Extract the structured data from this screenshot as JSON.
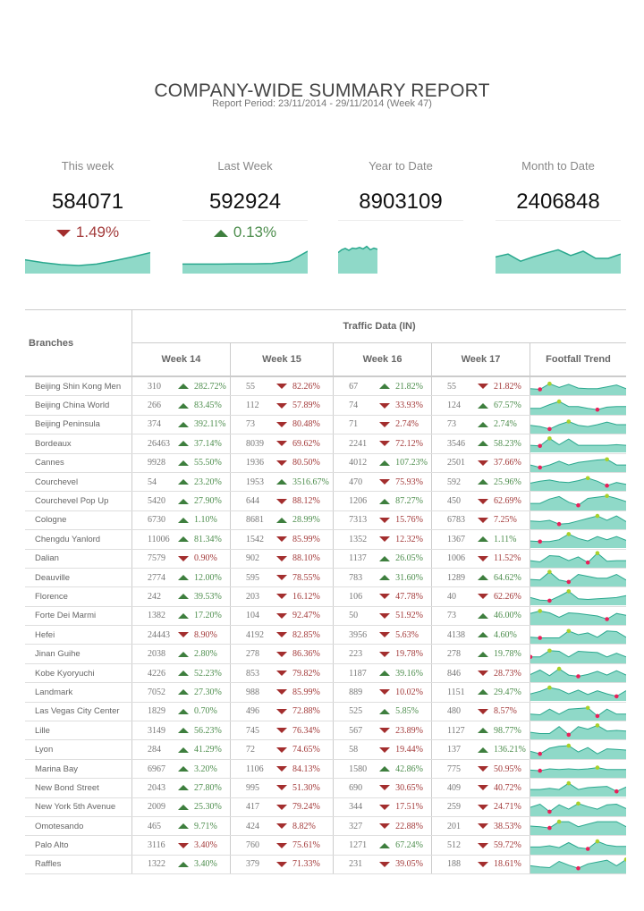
{
  "header": {
    "title": "COMPANY-WIDE SUMMARY REPORT",
    "subtitle": "Report Period: 23/11/2014 - 29/11/2014 (Week 47)"
  },
  "colors": {
    "sparkline_fill": "#8fd9c8",
    "sparkline_line": "#2aa88e",
    "up": "#4e8e4e",
    "down": "#a33a3a",
    "max_marker": "#a9d12a",
    "min_marker": "#e8215a"
  },
  "kpis": [
    {
      "label": "This week",
      "value": "584071",
      "change": "1.49%",
      "direction": "down",
      "trend": [
        0.45,
        0.35,
        0.28,
        0.25,
        0.3,
        0.42,
        0.55,
        0.7
      ]
    },
    {
      "label": "Last Week",
      "value": "592924",
      "change": "0.13%",
      "direction": "up",
      "trend": [
        0.3,
        0.3,
        0.3,
        0.31,
        0.31,
        0.32,
        0.4,
        0.75
      ]
    },
    {
      "label": "Year to Date",
      "value": "8903109",
      "change": "",
      "direction": "",
      "trend": [
        0.7,
        0.8,
        0.85,
        0.78,
        0.86,
        0.84,
        0.88,
        0.83,
        0.92,
        0.8,
        0.86,
        0.82
      ]
    },
    {
      "label": "Month to Date",
      "value": "2406848",
      "change": "",
      "direction": "",
      "trend": [
        0.55,
        0.65,
        0.4,
        0.55,
        0.68,
        0.8,
        0.6,
        0.75,
        0.5,
        0.5,
        0.65
      ]
    }
  ],
  "table": {
    "branches_header": "Branches",
    "group_header": "Traffic Data (IN)",
    "columns": [
      "Week 14",
      "Week 15",
      "Week 16",
      "Week 17",
      "Footfall Trend"
    ],
    "rows": [
      {
        "branch": "Beijing Shin Kong Men",
        "weeks": [
          [
            "310",
            "up",
            "282.72%"
          ],
          [
            "55",
            "down",
            "82.26%"
          ],
          [
            "67",
            "up",
            "21.82%"
          ],
          [
            "55",
            "down",
            "21.82%"
          ]
        ],
        "trend": [
          0.3,
          0.25,
          0.7,
          0.4,
          0.65,
          0.35,
          0.3,
          0.3,
          0.45,
          0.6,
          0.3
        ]
      },
      {
        "branch": "Beijing China World",
        "weeks": [
          [
            "266",
            "up",
            "83.45%"
          ],
          [
            "112",
            "down",
            "57.89%"
          ],
          [
            "74",
            "down",
            "33.93%"
          ],
          [
            "124",
            "up",
            "67.57%"
          ]
        ],
        "trend": [
          0.3,
          0.3,
          0.6,
          0.85,
          0.45,
          0.45,
          0.3,
          0.2,
          0.4,
          0.45,
          0.45
        ]
      },
      {
        "branch": "Beijing Peninsula",
        "weeks": [
          [
            "374",
            "up",
            "392.11%"
          ],
          [
            "73",
            "down",
            "80.48%"
          ],
          [
            "71",
            "down",
            "2.74%"
          ],
          [
            "73",
            "up",
            "2.74%"
          ]
        ],
        "trend": [
          0.45,
          0.35,
          0.15,
          0.5,
          0.75,
          0.45,
          0.35,
          0.5,
          0.7,
          0.5,
          0.5
        ]
      },
      {
        "branch": "Bordeaux",
        "weeks": [
          [
            "26463",
            "up",
            "37.14%"
          ],
          [
            "8039",
            "down",
            "69.62%"
          ],
          [
            "2241",
            "down",
            "72.12%"
          ],
          [
            "3546",
            "up",
            "58.23%"
          ]
        ],
        "trend": [
          0.35,
          0.3,
          0.9,
          0.4,
          0.85,
          0.35,
          0.35,
          0.35,
          0.35,
          0.4,
          0.35
        ]
      },
      {
        "branch": "Cannes",
        "weeks": [
          [
            "9928",
            "up",
            "55.50%"
          ],
          [
            "1936",
            "down",
            "80.50%"
          ],
          [
            "4012",
            "up",
            "107.23%"
          ],
          [
            "2501",
            "down",
            "37.66%"
          ]
        ],
        "trend": [
          0.35,
          0.15,
          0.35,
          0.65,
          0.35,
          0.55,
          0.65,
          0.75,
          0.8,
          0.35,
          0.35
        ]
      },
      {
        "branch": "Courchevel",
        "weeks": [
          [
            "54",
            "up",
            "23.20%"
          ],
          [
            "1953",
            "up",
            "3516.67%"
          ],
          [
            "470",
            "down",
            "75.93%"
          ],
          [
            "592",
            "up",
            "25.96%"
          ]
        ],
        "trend": [
          0.4,
          0.55,
          0.65,
          0.5,
          0.45,
          0.6,
          0.8,
          0.55,
          0.2,
          0.45,
          0.3
        ]
      },
      {
        "branch": "Courchevel Pop Up",
        "weeks": [
          [
            "5420",
            "up",
            "27.90%"
          ],
          [
            "644",
            "down",
            "88.12%"
          ],
          [
            "1206",
            "up",
            "87.27%"
          ],
          [
            "450",
            "down",
            "62.69%"
          ]
        ],
        "trend": [
          0.35,
          0.35,
          0.7,
          0.9,
          0.45,
          0.2,
          0.75,
          0.85,
          0.95,
          0.75,
          0.5
        ]
      },
      {
        "branch": "Cologne",
        "weeks": [
          [
            "6730",
            "up",
            "1.10%"
          ],
          [
            "8681",
            "up",
            "28.99%"
          ],
          [
            "7313",
            "down",
            "15.76%"
          ],
          [
            "6783",
            "down",
            "7.25%"
          ]
        ],
        "trend": [
          0.45,
          0.4,
          0.5,
          0.2,
          0.25,
          0.45,
          0.65,
          0.85,
          0.5,
          0.85,
          0.4
        ]
      },
      {
        "branch": "Chengdu Yanlord",
        "weeks": [
          [
            "11006",
            "up",
            "81.34%"
          ],
          [
            "1542",
            "down",
            "85.99%"
          ],
          [
            "1352",
            "down",
            "12.32%"
          ],
          [
            "1367",
            "up",
            "1.11%"
          ]
        ],
        "trend": [
          0.35,
          0.3,
          0.3,
          0.45,
          0.9,
          0.55,
          0.35,
          0.7,
          0.45,
          0.7,
          0.4
        ]
      },
      {
        "branch": "Dalian",
        "weeks": [
          [
            "7579",
            "down",
            "0.90%"
          ],
          [
            "902",
            "down",
            "88.10%"
          ],
          [
            "1137",
            "up",
            "26.05%"
          ],
          [
            "1006",
            "down",
            "11.52%"
          ]
        ],
        "trend": [
          0.35,
          0.25,
          0.75,
          0.7,
          0.35,
          0.65,
          0.2,
          0.95,
          0.3,
          0.35,
          0.35
        ]
      },
      {
        "branch": "Deauville",
        "weeks": [
          [
            "2774",
            "up",
            "12.00%"
          ],
          [
            "595",
            "down",
            "78.55%"
          ],
          [
            "783",
            "up",
            "31.60%"
          ],
          [
            "1289",
            "up",
            "64.62%"
          ]
        ],
        "trend": [
          0.35,
          0.3,
          0.95,
          0.3,
          0.15,
          0.75,
          0.6,
          0.45,
          0.45,
          0.75,
          0.3
        ]
      },
      {
        "branch": "Florence",
        "weeks": [
          [
            "242",
            "up",
            "39.53%"
          ],
          [
            "203",
            "down",
            "16.12%"
          ],
          [
            "106",
            "down",
            "47.78%"
          ],
          [
            "40",
            "down",
            "62.26%"
          ]
        ],
        "trend": [
          0.4,
          0.2,
          0.15,
          0.5,
          0.9,
          0.3,
          0.25,
          0.3,
          0.35,
          0.4,
          0.55
        ]
      },
      {
        "branch": "Forte Dei Marmi",
        "weeks": [
          [
            "1382",
            "up",
            "17.20%"
          ],
          [
            "104",
            "down",
            "92.47%"
          ],
          [
            "50",
            "down",
            "51.92%"
          ],
          [
            "73",
            "up",
            "46.00%"
          ]
        ],
        "trend": [
          0.7,
          0.9,
          0.75,
          0.4,
          0.75,
          0.7,
          0.6,
          0.5,
          0.25,
          0.7,
          0.55
        ]
      },
      {
        "branch": "Hefei",
        "weeks": [
          [
            "24443",
            "down",
            "8.90%"
          ],
          [
            "4192",
            "down",
            "82.85%"
          ],
          [
            "3956",
            "down",
            "5.63%"
          ],
          [
            "4138",
            "up",
            "4.60%"
          ]
        ],
        "trend": [
          0.3,
          0.25,
          0.25,
          0.25,
          0.8,
          0.5,
          0.65,
          0.3,
          0.8,
          0.75,
          0.3
        ]
      },
      {
        "branch": "Jinan Guihe",
        "weeks": [
          [
            "2038",
            "up",
            "2.80%"
          ],
          [
            "278",
            "down",
            "86.36%"
          ],
          [
            "223",
            "down",
            "19.78%"
          ],
          [
            "278",
            "up",
            "19.78%"
          ]
        ],
        "trend": [
          0.3,
          0.3,
          0.8,
          0.75,
          0.3,
          0.75,
          0.7,
          0.65,
          0.3,
          0.6,
          0.3
        ]
      },
      {
        "branch": "Kobe Kyoryuchi",
        "weeks": [
          [
            "4226",
            "up",
            "52.23%"
          ],
          [
            "853",
            "down",
            "79.82%"
          ],
          [
            "1187",
            "up",
            "39.16%"
          ],
          [
            "846",
            "down",
            "28.73%"
          ]
        ],
        "trend": [
          0.4,
          0.75,
          0.3,
          0.85,
          0.35,
          0.25,
          0.4,
          0.65,
          0.35,
          0.7,
          0.35
        ]
      },
      {
        "branch": "Landmark",
        "weeks": [
          [
            "7052",
            "up",
            "27.30%"
          ],
          [
            "988",
            "down",
            "85.99%"
          ],
          [
            "889",
            "down",
            "10.02%"
          ],
          [
            "1151",
            "up",
            "29.47%"
          ]
        ],
        "trend": [
          0.35,
          0.55,
          0.85,
          0.7,
          0.35,
          0.65,
          0.3,
          0.6,
          0.35,
          0.15,
          0.6
        ]
      },
      {
        "branch": "Las Vegas City Center",
        "weeks": [
          [
            "1829",
            "up",
            "0.70%"
          ],
          [
            "496",
            "down",
            "72.88%"
          ],
          [
            "525",
            "up",
            "5.85%"
          ],
          [
            "480",
            "down",
            "8.57%"
          ]
        ],
        "trend": [
          0.3,
          0.25,
          0.7,
          0.3,
          0.7,
          0.75,
          0.8,
          0.15,
          0.7,
          0.3,
          0.3
        ]
      },
      {
        "branch": "Lille",
        "weeks": [
          [
            "3149",
            "up",
            "56.23%"
          ],
          [
            "745",
            "down",
            "76.34%"
          ],
          [
            "567",
            "down",
            "23.89%"
          ],
          [
            "1127",
            "up",
            "98.77%"
          ]
        ],
        "trend": [
          0.35,
          0.25,
          0.25,
          0.8,
          0.15,
          0.8,
          0.6,
          0.9,
          0.45,
          0.5,
          0.45
        ]
      },
      {
        "branch": "Lyon",
        "weeks": [
          [
            "284",
            "up",
            "41.29%"
          ],
          [
            "72",
            "down",
            "74.65%"
          ],
          [
            "58",
            "down",
            "19.44%"
          ],
          [
            "137",
            "up",
            "136.21%"
          ]
        ],
        "trend": [
          0.4,
          0.2,
          0.65,
          0.8,
          0.85,
          0.35,
          0.7,
          0.2,
          0.6,
          0.55,
          0.5
        ]
      },
      {
        "branch": "Marina Bay",
        "weeks": [
          [
            "6967",
            "up",
            "3.20%"
          ],
          [
            "1106",
            "down",
            "84.13%"
          ],
          [
            "1580",
            "up",
            "42.86%"
          ],
          [
            "775",
            "down",
            "50.95%"
          ]
        ],
        "trend": [
          0.4,
          0.35,
          0.5,
          0.45,
          0.5,
          0.45,
          0.5,
          0.6,
          0.45,
          0.45,
          0.45
        ]
      },
      {
        "branch": "New Bond Street",
        "weeks": [
          [
            "2043",
            "up",
            "27.80%"
          ],
          [
            "995",
            "down",
            "51.30%"
          ],
          [
            "690",
            "down",
            "30.65%"
          ],
          [
            "409",
            "down",
            "40.72%"
          ]
        ],
        "trend": [
          0.35,
          0.35,
          0.45,
          0.35,
          0.85,
          0.35,
          0.5,
          0.55,
          0.6,
          0.2,
          0.55
        ]
      },
      {
        "branch": "New York 5th Avenue",
        "weeks": [
          [
            "2009",
            "up",
            "25.30%"
          ],
          [
            "417",
            "down",
            "79.24%"
          ],
          [
            "344",
            "down",
            "17.51%"
          ],
          [
            "259",
            "down",
            "24.71%"
          ]
        ],
        "trend": [
          0.5,
          0.75,
          0.15,
          0.7,
          0.35,
          0.8,
          0.55,
          0.35,
          0.7,
          0.75,
          0.4
        ]
      },
      {
        "branch": "Omotesando",
        "weeks": [
          [
            "465",
            "up",
            "9.71%"
          ],
          [
            "424",
            "down",
            "8.82%"
          ],
          [
            "327",
            "down",
            "22.88%"
          ],
          [
            "201",
            "down",
            "38.53%"
          ]
        ],
        "trend": [
          0.5,
          0.45,
          0.35,
          0.85,
          0.85,
          0.45,
          0.65,
          0.85,
          0.85,
          0.85,
          0.45
        ]
      },
      {
        "branch": "Palo Alto",
        "weeks": [
          [
            "3116",
            "down",
            "3.40%"
          ],
          [
            "760",
            "down",
            "75.61%"
          ],
          [
            "1271",
            "up",
            "67.24%"
          ],
          [
            "512",
            "down",
            "59.72%"
          ]
        ],
        "trend": [
          0.4,
          0.4,
          0.5,
          0.35,
          0.75,
          0.35,
          0.25,
          0.85,
          0.55,
          0.45,
          0.45
        ]
      },
      {
        "branch": "Raffles",
        "weeks": [
          [
            "1322",
            "up",
            "3.40%"
          ],
          [
            "379",
            "down",
            "71.33%"
          ],
          [
            "231",
            "down",
            "39.05%"
          ],
          [
            "188",
            "down",
            "18.61%"
          ]
        ],
        "trend": [
          0.4,
          0.3,
          0.25,
          0.75,
          0.45,
          0.2,
          0.55,
          0.7,
          0.85,
          0.4,
          0.9
        ]
      }
    ]
  }
}
